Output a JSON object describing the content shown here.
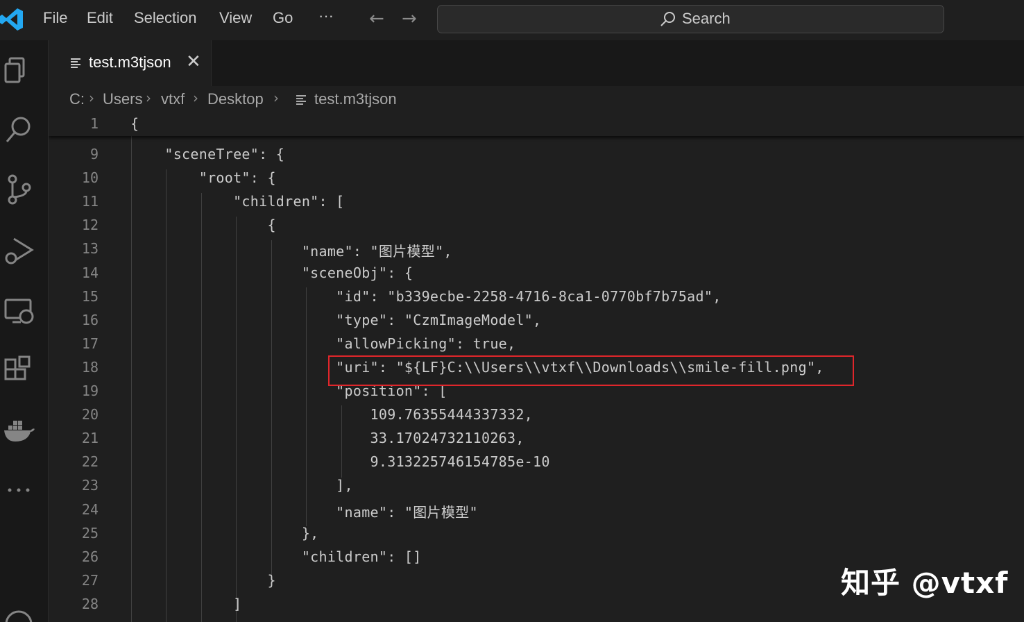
{
  "titlebar": {
    "menu": [
      "File",
      "Edit",
      "Selection",
      "View",
      "Go",
      "···"
    ],
    "back_icon": "arrow-left-icon",
    "forward_icon": "arrow-right-icon",
    "search_label": "Search"
  },
  "tab": {
    "label": "test.m3tjson",
    "close": "✕"
  },
  "breadcrumb": [
    "C:",
    "Users",
    "vtxf",
    "Desktop",
    "test.m3tjson"
  ],
  "editor": {
    "sticky_line": {
      "num": "1",
      "text": "{"
    },
    "lines": [
      {
        "num": "9",
        "text": "    \"sceneTree\": {"
      },
      {
        "num": "10",
        "text": "        \"root\": {"
      },
      {
        "num": "11",
        "text": "            \"children\": ["
      },
      {
        "num": "12",
        "text": "                {"
      },
      {
        "num": "13",
        "text": "                    \"name\": \"图片模型\","
      },
      {
        "num": "14",
        "text": "                    \"sceneObj\": {"
      },
      {
        "num": "15",
        "text": "                        \"id\": \"b339ecbe-2258-4716-8ca1-0770bf7b75ad\","
      },
      {
        "num": "16",
        "text": "                        \"type\": \"CzmImageModel\","
      },
      {
        "num": "17",
        "text": "                        \"allowPicking\": true,"
      },
      {
        "num": "18",
        "text": "                        \"uri\": \"${LF}C:\\\\Users\\\\vtxf\\\\Downloads\\\\smile-fill.png\","
      },
      {
        "num": "19",
        "text": "                        \"position\": ["
      },
      {
        "num": "20",
        "text": "                            109.76355444337332,"
      },
      {
        "num": "21",
        "text": "                            33.17024732110263,"
      },
      {
        "num": "22",
        "text": "                            9.313225746154785e-10"
      },
      {
        "num": "23",
        "text": "                        ],"
      },
      {
        "num": "24",
        "text": "                        \"name\": \"图片模型\""
      },
      {
        "num": "25",
        "text": "                    },"
      },
      {
        "num": "26",
        "text": "                    \"children\": []"
      },
      {
        "num": "27",
        "text": "                }"
      },
      {
        "num": "28",
        "text": "            ]"
      }
    ]
  },
  "watermark": "知乎 @vtxf",
  "colors": {
    "background": "#1f1f1f",
    "activitybar": "#181818",
    "highlight_border": "#e0262b",
    "vscode_blue": "#23a8f2"
  }
}
